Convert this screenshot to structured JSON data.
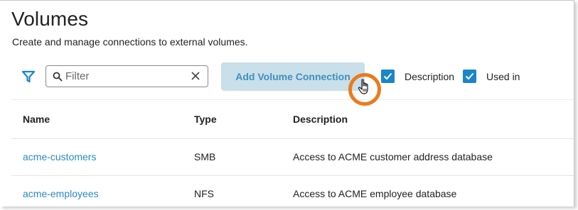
{
  "page": {
    "title": "Volumes",
    "subtitle": "Create and manage connections to external volumes."
  },
  "toolbar": {
    "filter_icon": "funnel-icon",
    "filter_placeholder": "Filter",
    "filter_value": "",
    "add_button_label": "Add Volume Connection",
    "checkboxes": [
      {
        "label": "Description",
        "checked": true
      },
      {
        "label": "Used in",
        "checked": true
      }
    ]
  },
  "table": {
    "columns": [
      "Name",
      "Type",
      "Description"
    ],
    "rows": [
      {
        "name": "acme-customers",
        "type": "SMB",
        "description": "Access to ACME customer address database"
      },
      {
        "name": "acme-employees",
        "type": "NFS",
        "description": "Access to ACME employee database"
      }
    ]
  },
  "colors": {
    "accent": "#1a86c8",
    "link": "#2a8ac4",
    "button_bg": "#c9dfea",
    "highlight": "#ec7a1c"
  }
}
